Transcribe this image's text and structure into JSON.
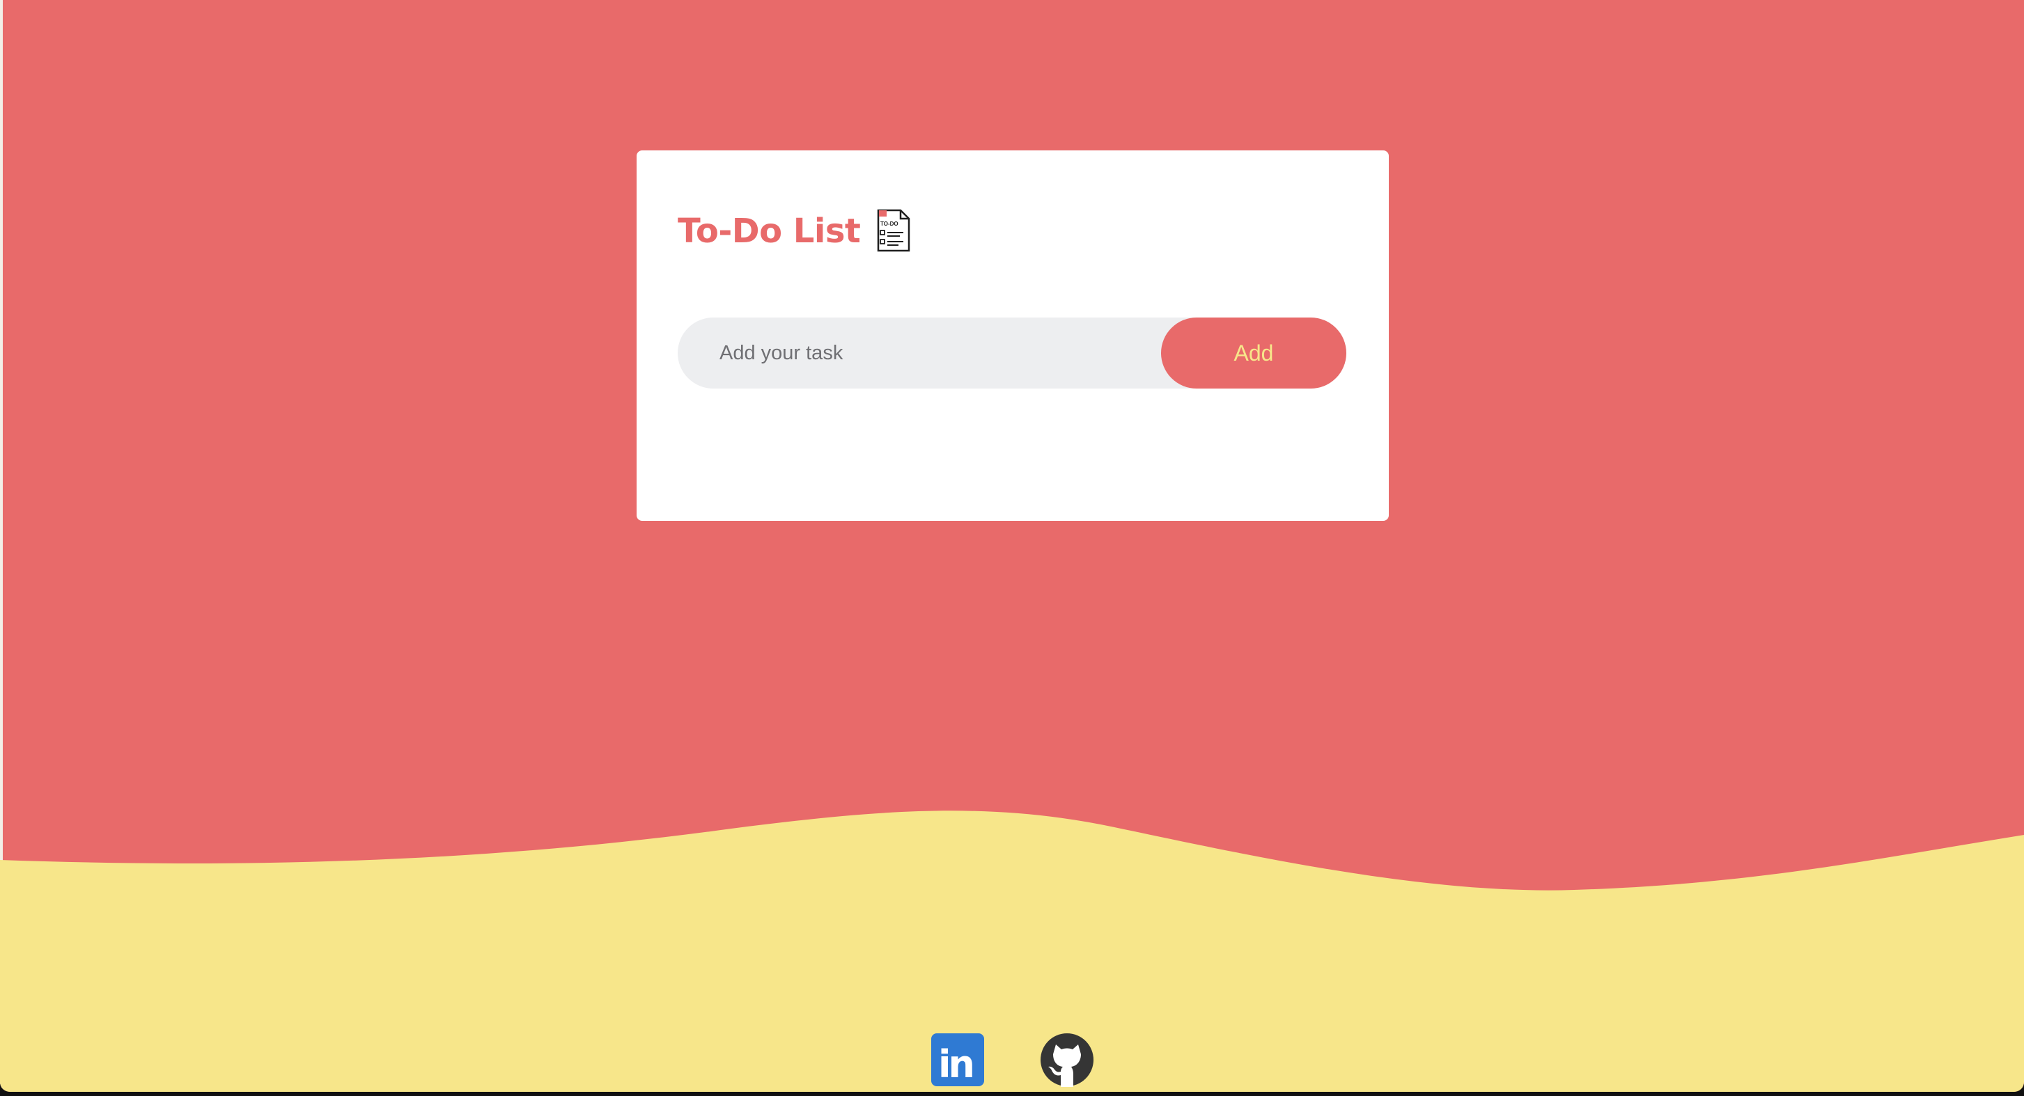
{
  "app": {
    "title": "To-Do List",
    "title_icon": "todo-list-document-icon",
    "todo_icon_text": "TO-DO"
  },
  "task_form": {
    "input_placeholder": "Add your task",
    "input_value": "",
    "add_label": "Add"
  },
  "footer": {
    "links": [
      {
        "name": "LinkedIn",
        "icon": "linkedin-icon",
        "label": "in"
      },
      {
        "name": "GitHub",
        "icon": "github-icon"
      }
    ]
  },
  "colors": {
    "background": "#e86a6a",
    "wave": "#f7e68a",
    "card": "#ffffff",
    "input_background": "#edeef0",
    "button_text": "#f7e68a",
    "linkedin": "#2f7ad3",
    "github": "#353535"
  }
}
